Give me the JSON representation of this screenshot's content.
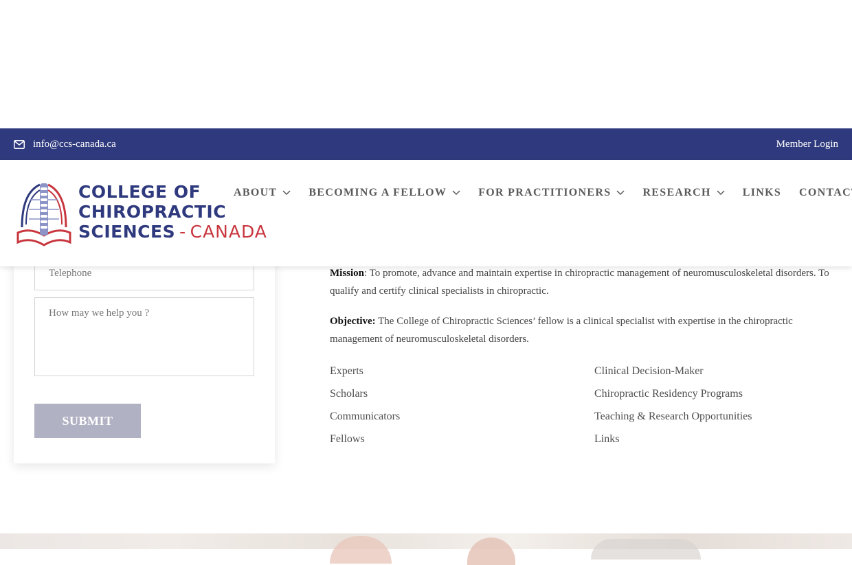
{
  "topbar": {
    "email": "info@ccs-canada.ca",
    "email_icon": "envelope-icon",
    "member_login": "Member Login"
  },
  "logo": {
    "line1": "COLLEGE OF",
    "line2": "CHIROPRACTIC",
    "line3_main": "SCIENCES",
    "line3_dash": "-",
    "line3_canada": "CANADA"
  },
  "nav": {
    "items": [
      {
        "label": "ABOUT",
        "has_dropdown": true
      },
      {
        "label": "BECOMING A FELLOW",
        "has_dropdown": true
      },
      {
        "label": "FOR PRACTITIONERS",
        "has_dropdown": true
      },
      {
        "label": "RESEARCH",
        "has_dropdown": true
      },
      {
        "label": "LINKS",
        "has_dropdown": false
      },
      {
        "label": "CONTACT",
        "has_dropdown": false
      }
    ]
  },
  "form": {
    "telephone_placeholder": "Telephone",
    "message_placeholder": "How may we help you ?",
    "submit_label": "SUBMIT"
  },
  "content": {
    "mission_label": "Mission",
    "mission_text": ": To promote, advance and maintain expertise in chiropractic management of neuromusculoskeletal disorders. To qualify and certify clinical specialists in chiropractic.",
    "objective_label": "Objective:",
    "objective_text": " The College of Chiropractic Sciences’ fellow is a clinical specialist with expertise in the chiropractic management of neuromusculoskeletal disorders."
  },
  "quick_links": {
    "left": [
      "Experts",
      "Scholars",
      "Communicators",
      "Fellows"
    ],
    "right": [
      "Clinical Decision-Maker",
      "Chiropractic Residency Programs",
      "Teaching & Research Opportunities",
      "Links"
    ]
  },
  "colors": {
    "brand_navy": "#2f3a7e",
    "brand_red": "#c8363e",
    "submit_bg": "#b1b1c4"
  }
}
